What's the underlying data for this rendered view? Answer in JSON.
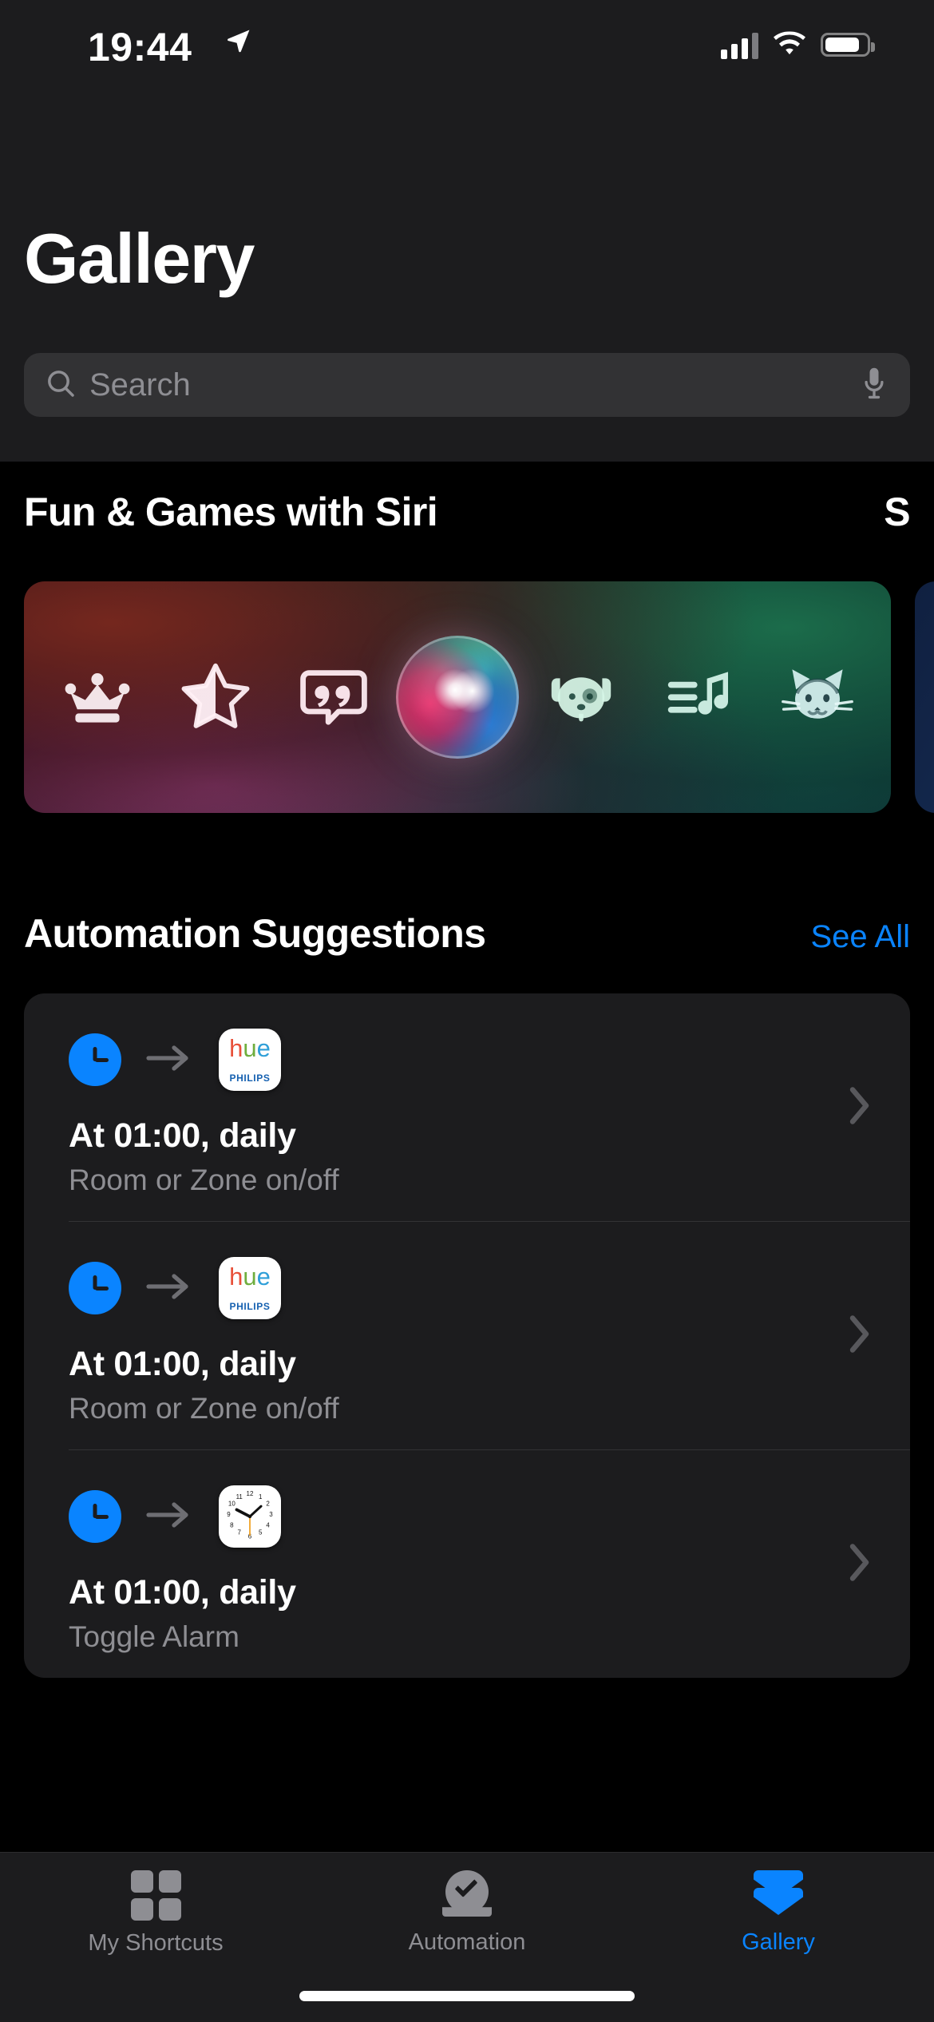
{
  "status_bar": {
    "time": "19:44",
    "location_icon": "location-arrow-icon",
    "cellular_icon": "cellular-signal-icon",
    "wifi_icon": "wifi-icon",
    "battery_icon": "battery-icon"
  },
  "header": {
    "title": "Gallery"
  },
  "search": {
    "placeholder": "Search",
    "value": "",
    "search_icon": "search-icon",
    "mic_icon": "microphone-icon"
  },
  "featured": {
    "section_title": "Fun & Games with Siri",
    "next_section_title": "S",
    "banner_icons": [
      "crown-icon",
      "half-star-icon",
      "quote-bubble-icon",
      "siri-orb-icon",
      "dog-face-icon",
      "music-playlist-icon",
      "cat-face-icon"
    ]
  },
  "automation": {
    "section_title": "Automation Suggestions",
    "see_all_label": "See All",
    "rows": [
      {
        "trigger_icon": "clock-trigger-icon",
        "arrow_icon": "arrow-right-icon",
        "app_icon": "philips-hue-app-icon",
        "app_logo_h": "h",
        "app_logo_u": "u",
        "app_logo_e": "e",
        "app_brand": "PHILIPS",
        "title": "At 01:00, daily",
        "subtitle": "Room or Zone on/off",
        "chevron_icon": "chevron-right-icon"
      },
      {
        "trigger_icon": "clock-trigger-icon",
        "arrow_icon": "arrow-right-icon",
        "app_icon": "philips-hue-app-icon",
        "app_logo_h": "h",
        "app_logo_u": "u",
        "app_logo_e": "e",
        "app_brand": "PHILIPS",
        "title": "At 01:00, daily",
        "subtitle": "Room or Zone on/off",
        "chevron_icon": "chevron-right-icon"
      },
      {
        "trigger_icon": "clock-trigger-icon",
        "arrow_icon": "arrow-right-icon",
        "app_icon": "clock-app-icon",
        "title": "At 01:00, daily",
        "subtitle": "Toggle Alarm",
        "chevron_icon": "chevron-right-icon"
      }
    ]
  },
  "tab_bar": {
    "tabs": [
      {
        "label": "My Shortcuts",
        "icon": "grid-squares-icon",
        "active": false
      },
      {
        "label": "Automation",
        "icon": "automation-clock-icon",
        "active": false
      },
      {
        "label": "Gallery",
        "icon": "gallery-layers-icon",
        "active": true
      }
    ]
  },
  "colors": {
    "accent": "#0a84ff",
    "background": "#000000",
    "card": "#1c1c1e",
    "secondary_text": "#8e8e93"
  }
}
